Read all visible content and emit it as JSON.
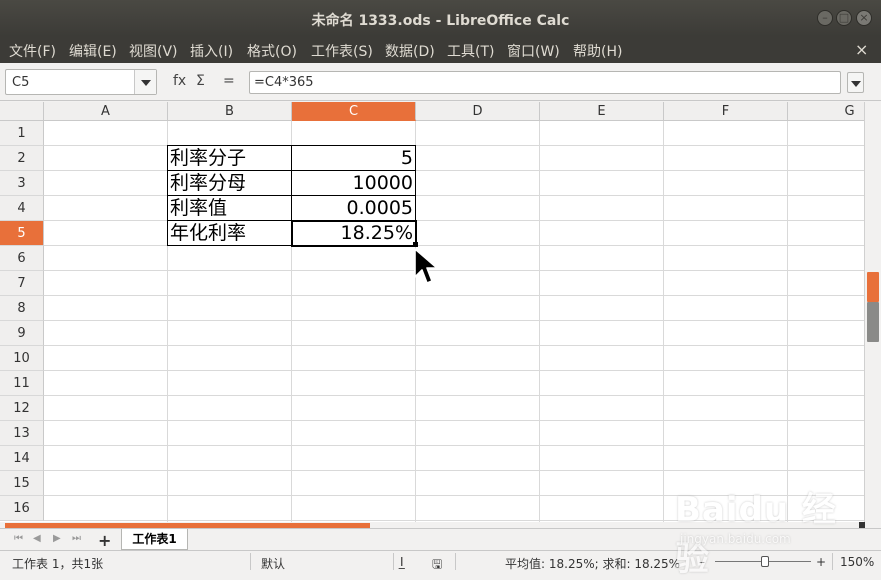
{
  "window": {
    "title": "未命名 1333.ods - LibreOffice Calc",
    "buttons": {
      "minimize": "–",
      "maximize": "□",
      "close": "×"
    }
  },
  "menubar": {
    "items": [
      "文件(F)",
      "编辑(E)",
      "视图(V)",
      "插入(I)",
      "格式(O)",
      "工作表(S)",
      "数据(D)",
      "工具(T)",
      "窗口(W)",
      "帮助(H)"
    ],
    "close_doc": "×"
  },
  "formula_bar": {
    "name_box": "C5",
    "fx_symbol": "fx",
    "sum_symbol": "Σ",
    "equals_symbol": "=",
    "formula": "=C4*365"
  },
  "grid": {
    "active_cell": "C5",
    "columns": [
      "A",
      "B",
      "C",
      "D",
      "E",
      "F",
      "G"
    ],
    "rows": [
      "1",
      "2",
      "3",
      "4",
      "5",
      "6",
      "7",
      "8",
      "9",
      "10",
      "11",
      "12",
      "13",
      "14",
      "15",
      "16"
    ],
    "cells": {
      "B2": "利率分子",
      "C2": "5",
      "B3": "利率分母",
      "C3": "10000",
      "B4": "利率值",
      "C4": "0.0005",
      "B5": "年化利率",
      "C5": "18.25%"
    }
  },
  "sheet_tabs": {
    "nav": [
      "⏮",
      "◀",
      "▶",
      "⏭"
    ],
    "add": "+",
    "tabs": [
      "工作表1"
    ]
  },
  "statusbar": {
    "sheet_info": "工作表 1，共1张",
    "page_style": "默认",
    "insert_mode": "I̲",
    "summary": "平均值: 18.25%; 求和: 18.25%",
    "zoom_minus": "–",
    "zoom_plus": "+",
    "zoom": "150%"
  },
  "watermark": {
    "brand": "Baidu 经验",
    "url": "jingyan.baidu.com"
  },
  "colors": {
    "accent": "#e8703a",
    "titlebar": "#3c3b37",
    "menu_text": "#dfdbd2"
  }
}
